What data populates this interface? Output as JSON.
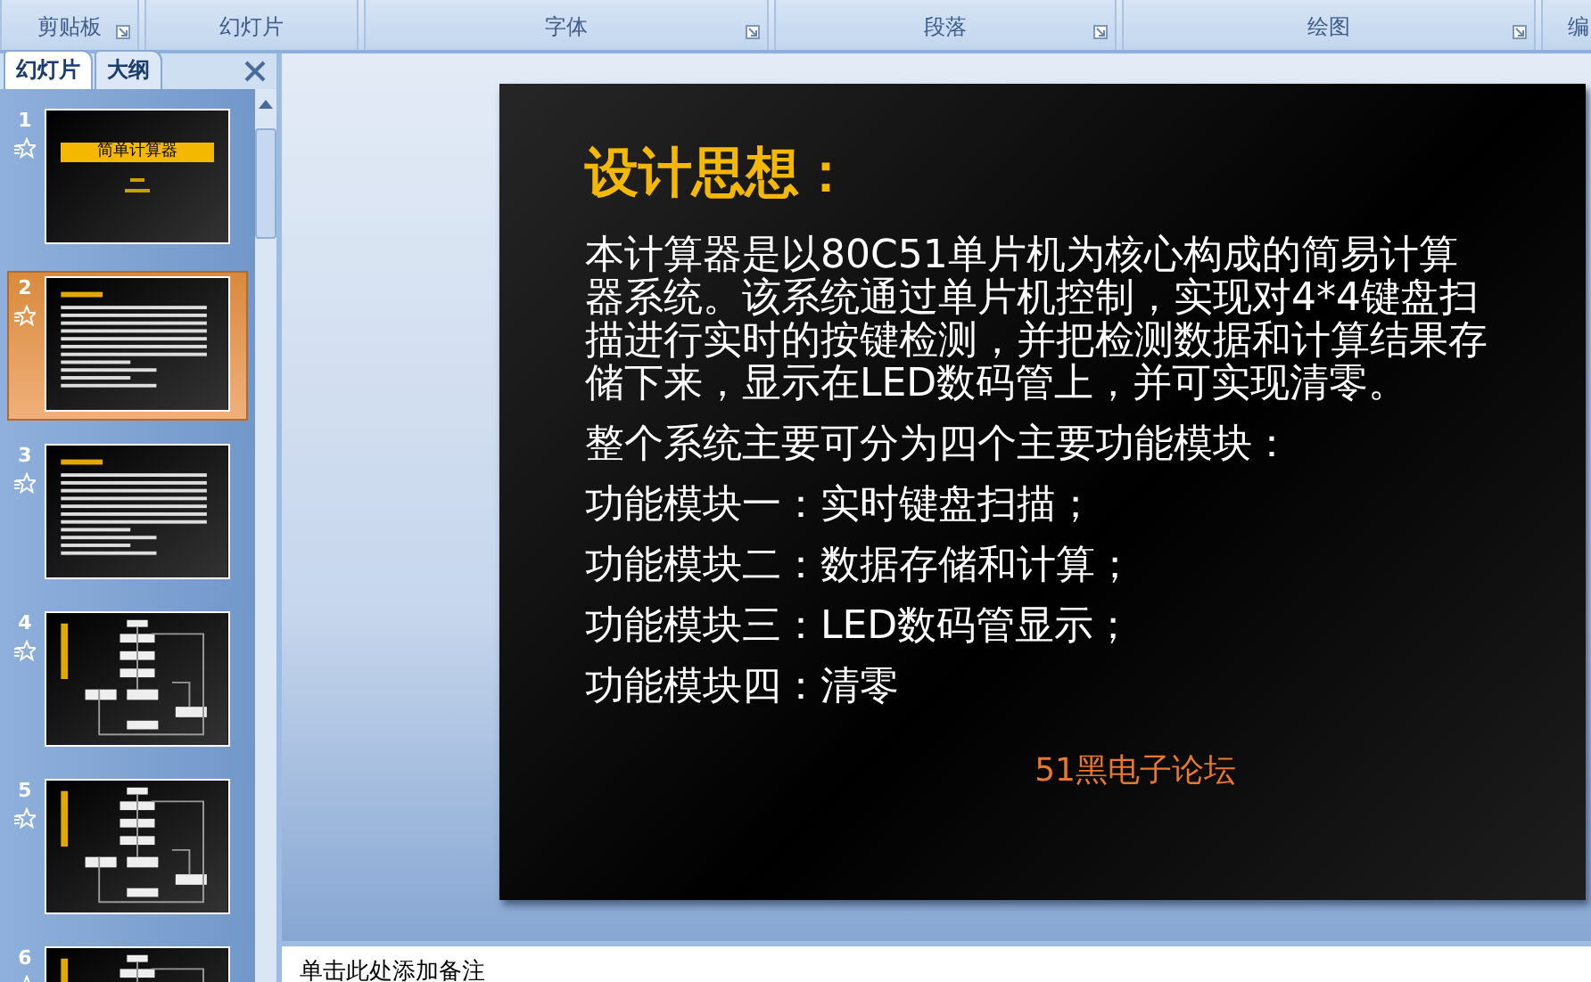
{
  "ribbon_groups": [
    {
      "label": "剪贴板",
      "launcher": true
    },
    {
      "label": "幻灯片",
      "launcher": false
    },
    {
      "label": "字体",
      "launcher": true
    },
    {
      "label": "段落",
      "launcher": true
    },
    {
      "label": "绘图",
      "launcher": true
    },
    {
      "label": "编"
    }
  ],
  "panel_tabs": [
    {
      "label": "幻灯片",
      "selected": true
    },
    {
      "label": "大纲",
      "selected": false
    }
  ],
  "thumbnails": [
    {
      "number": "1",
      "kind": "title",
      "title": "简单计算器",
      "selected": false
    },
    {
      "number": "2",
      "kind": "text",
      "selected": true
    },
    {
      "number": "3",
      "kind": "text",
      "selected": false
    },
    {
      "number": "4",
      "kind": "flowchart",
      "selected": false
    },
    {
      "number": "5",
      "kind": "flowchart",
      "selected": false
    },
    {
      "number": "6",
      "kind": "flowchart",
      "selected": false
    }
  ],
  "slide": {
    "title": "设计思想：",
    "paragraphs": [
      "本计算器是以80C51单片机为核心构成的简易计算器系统。该系统通过单片机控制，实现对4*4键盘扫描进行实时的按键检测，并把检测数据和计算结果存储下来，显示在LED数码管上，并可实现清零。",
      "整个系统主要可分为四个主要功能模块：",
      "功能模块一：实时键盘扫描；",
      "功能模块二：数据存储和计算；",
      "功能模块三：LED数码管显示；",
      "功能模块四：清零"
    ],
    "footer": "51黑电子论坛"
  },
  "notes": {
    "placeholder": "单击此处添加备注"
  }
}
